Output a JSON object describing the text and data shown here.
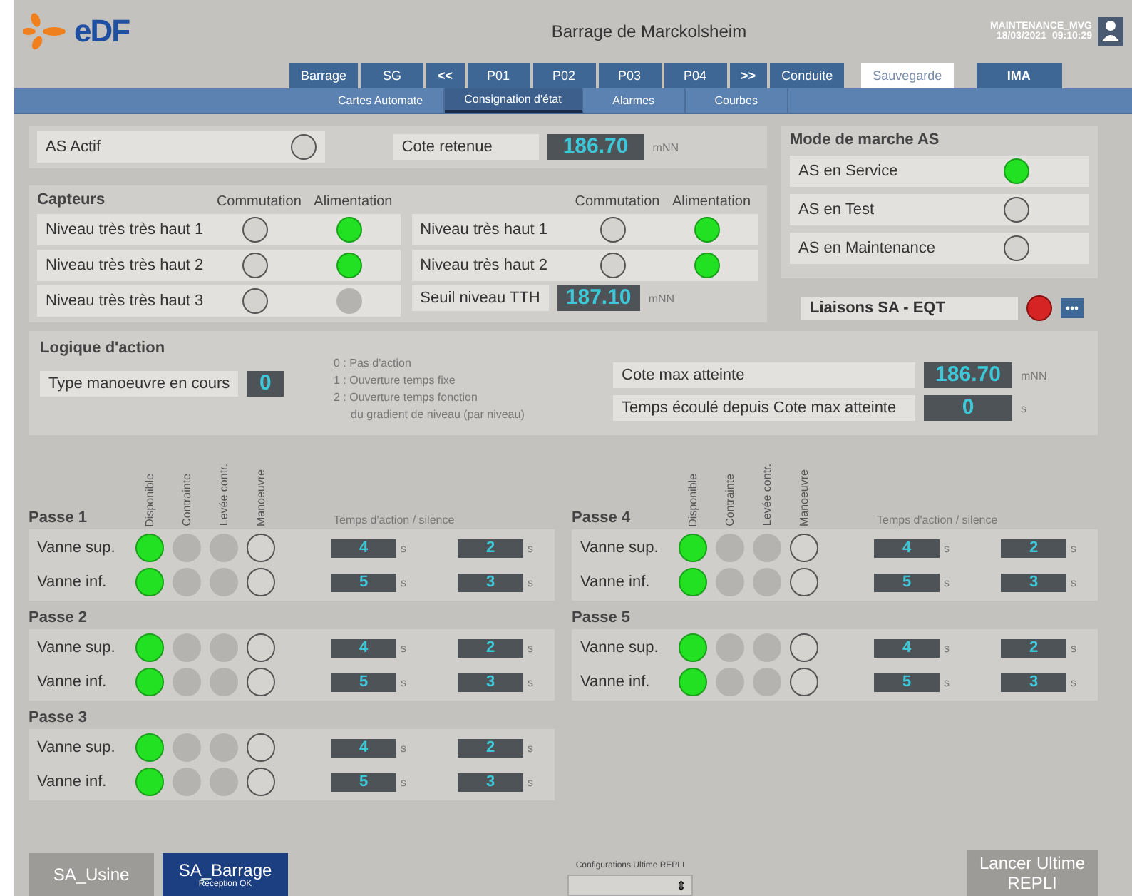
{
  "header": {
    "logo": "eDF",
    "title": "Barrage de Marckolsheim",
    "user": "MAINTENANCE_MVG",
    "date": "18/03/2021",
    "time": "09:10:29"
  },
  "nav": [
    {
      "label": "Barrage",
      "kind": "nav",
      "selected": false
    },
    {
      "label": "SG",
      "kind": "nav",
      "selected": false
    },
    {
      "label": "<<",
      "kind": "arrow",
      "selected": false
    },
    {
      "label": "P01",
      "kind": "nav",
      "selected": false
    },
    {
      "label": "P02",
      "kind": "nav",
      "selected": false
    },
    {
      "label": "P03",
      "kind": "nav",
      "selected": false
    },
    {
      "label": "P04",
      "kind": "nav",
      "selected": false
    },
    {
      "label": ">>",
      "kind": "arrow",
      "selected": false
    },
    {
      "label": "Conduite",
      "kind": "nav",
      "selected": false
    },
    {
      "label": "Sauvegarde",
      "kind": "save",
      "selected": false
    },
    {
      "label": "IMA",
      "kind": "ima",
      "selected": false
    }
  ],
  "subtabs": [
    {
      "label": "Cartes Automate",
      "selected": false
    },
    {
      "label": "Consignation d'état",
      "selected": true
    },
    {
      "label": "Alarmes",
      "selected": false
    },
    {
      "label": "Courbes",
      "selected": false
    }
  ],
  "as_actif": {
    "label": "AS Actif",
    "on": false
  },
  "cote_retenue": {
    "label": "Cote retenue",
    "value": "186.70",
    "unit": "mNN"
  },
  "capteurs": {
    "title": "Capteurs",
    "left": {
      "headers": [
        "Commutation",
        "Alimentation"
      ],
      "rows": [
        {
          "label": "Niveau très très haut 1",
          "commutation": {
            "on": false,
            "disabled": false
          },
          "alimentation": {
            "on": true,
            "disabled": false
          }
        },
        {
          "label": "Niveau très très haut 2",
          "commutation": {
            "on": false,
            "disabled": false
          },
          "alimentation": {
            "on": true,
            "disabled": false
          }
        },
        {
          "label": "Niveau très très haut 3",
          "commutation": {
            "on": false,
            "disabled": false
          },
          "alimentation": {
            "disabled": true
          }
        }
      ]
    },
    "right": {
      "headers": [
        "Commutation",
        "Alimentation"
      ],
      "rows": [
        {
          "label": "Niveau très haut 1",
          "commutation": {
            "on": false,
            "disabled": false
          },
          "alimentation": {
            "on": true,
            "disabled": false
          }
        },
        {
          "label": "Niveau très haut 2",
          "commutation": {
            "on": false,
            "disabled": false
          },
          "alimentation": {
            "on": true,
            "disabled": false
          }
        }
      ],
      "seuil": {
        "label": "Seuil niveau TTH",
        "value": "187.10",
        "unit": "mNN"
      }
    }
  },
  "mode": {
    "title": "Mode de marche AS",
    "items": [
      {
        "label": "AS en Service",
        "on": true
      },
      {
        "label": "AS en Test",
        "on": false
      },
      {
        "label": "AS en Maintenance",
        "on": false
      }
    ]
  },
  "liaisons": {
    "label": "Liaisons SA - EQT",
    "alarm": true
  },
  "logique": {
    "title": "Logique d'action",
    "type_label": "Type manoeuvre en cours",
    "type_value": "0",
    "legend": [
      "0 : Pas d'action",
      "1 : Ouverture temps fixe",
      "2 : Ouverture temps fonction",
      "du gradient de niveau (par niveau)"
    ],
    "cote_max": {
      "label": "Cote max atteinte",
      "value": "186.70",
      "unit": "mNN"
    },
    "temps": {
      "label": "Temps écoulé depuis Cote max atteinte",
      "value": "0",
      "unit": "s"
    }
  },
  "pass_columns": [
    {
      "headers": [
        "Disponible",
        "Contrainte",
        "Levée contr.",
        "Manoeuvre"
      ],
      "timing_header": "Temps d'action  / silence",
      "passes": [
        {
          "name": "Passe 1",
          "rows": [
            {
              "label": "Vanne sup.",
              "lamps": [
                {
                  "on": true,
                  "disabled": false
                },
                {
                  "disabled": true
                },
                {
                  "disabled": true
                },
                {
                  "on": false,
                  "disabled": false
                }
              ],
              "action": "4",
              "action_unit": "s",
              "silence": "2",
              "silence_unit": "s"
            },
            {
              "label": "Vanne inf.",
              "lamps": [
                {
                  "on": true,
                  "disabled": false
                },
                {
                  "disabled": true
                },
                {
                  "disabled": true
                },
                {
                  "on": false,
                  "disabled": false
                }
              ],
              "action": "5",
              "action_unit": "s",
              "silence": "3",
              "silence_unit": "s"
            }
          ]
        },
        {
          "name": "Passe 2",
          "rows": [
            {
              "label": "Vanne sup.",
              "lamps": [
                {
                  "on": true,
                  "disabled": false
                },
                {
                  "disabled": true
                },
                {
                  "disabled": true
                },
                {
                  "on": false,
                  "disabled": false
                }
              ],
              "action": "4",
              "action_unit": "s",
              "silence": "2",
              "silence_unit": "s"
            },
            {
              "label": "Vanne inf.",
              "lamps": [
                {
                  "on": true,
                  "disabled": false
                },
                {
                  "disabled": true
                },
                {
                  "disabled": true
                },
                {
                  "on": false,
                  "disabled": false
                }
              ],
              "action": "5",
              "action_unit": "s",
              "silence": "3",
              "silence_unit": "s"
            }
          ]
        },
        {
          "name": "Passe 3",
          "rows": [
            {
              "label": "Vanne sup.",
              "lamps": [
                {
                  "on": true,
                  "disabled": false
                },
                {
                  "disabled": true
                },
                {
                  "disabled": true
                },
                {
                  "on": false,
                  "disabled": false
                }
              ],
              "action": "4",
              "action_unit": "s",
              "silence": "2",
              "silence_unit": "s"
            },
            {
              "label": "Vanne inf.",
              "lamps": [
                {
                  "on": true,
                  "disabled": false
                },
                {
                  "disabled": true
                },
                {
                  "disabled": true
                },
                {
                  "on": false,
                  "disabled": false
                }
              ],
              "action": "5",
              "action_unit": "s",
              "silence": "3",
              "silence_unit": "s"
            }
          ]
        }
      ]
    },
    {
      "headers": [
        "Disponible",
        "Contrainte",
        "Levée contr.",
        "Manoeuvre"
      ],
      "timing_header": "Temps d'action  / silence",
      "passes": [
        {
          "name": "Passe 4",
          "rows": [
            {
              "label": "Vanne sup.",
              "lamps": [
                {
                  "on": true,
                  "disabled": false
                },
                {
                  "disabled": true
                },
                {
                  "disabled": true
                },
                {
                  "on": false,
                  "disabled": false
                }
              ],
              "action": "4",
              "action_unit": "s",
              "silence": "2",
              "silence_unit": "s"
            },
            {
              "label": "Vanne inf.",
              "lamps": [
                {
                  "on": true,
                  "disabled": false
                },
                {
                  "disabled": true
                },
                {
                  "disabled": true
                },
                {
                  "on": false,
                  "disabled": false
                }
              ],
              "action": "5",
              "action_unit": "s",
              "silence": "3",
              "silence_unit": "s"
            }
          ]
        },
        {
          "name": "Passe 5",
          "rows": [
            {
              "label": "Vanne sup.",
              "lamps": [
                {
                  "on": true,
                  "disabled": false
                },
                {
                  "disabled": true
                },
                {
                  "disabled": true
                },
                {
                  "on": false,
                  "disabled": false
                }
              ],
              "action": "4",
              "action_unit": "s",
              "silence": "2",
              "silence_unit": "s"
            },
            {
              "label": "Vanne inf.",
              "lamps": [
                {
                  "on": true,
                  "disabled": false
                },
                {
                  "disabled": true
                },
                {
                  "disabled": true
                },
                {
                  "on": false,
                  "disabled": false
                }
              ],
              "action": "5",
              "action_unit": "s",
              "silence": "3",
              "silence_unit": "s"
            }
          ]
        }
      ]
    }
  ],
  "footer": {
    "systems": [
      {
        "label": "SA_Usine",
        "disabled": true
      },
      {
        "label": "SA_Barrage",
        "subtitle": "Réception OK",
        "disabled": false
      }
    ],
    "config_label": "Configurations Ultime REPLI",
    "spinner": "⇕",
    "launch": {
      "label": "Lancer Ultime REPLI",
      "disabled": true
    }
  }
}
